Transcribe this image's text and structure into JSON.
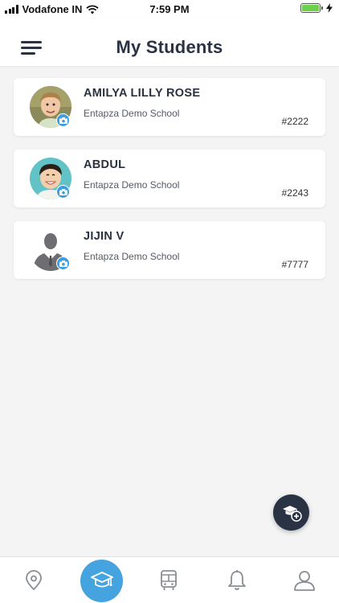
{
  "status_bar": {
    "carrier": "Vodafone IN",
    "time": "7:59 PM",
    "battery_level": 1.0,
    "battery_color": "#6cd04a"
  },
  "header": {
    "title": "My Students",
    "menu_icon": "hamburger-menu-icon"
  },
  "students": [
    {
      "name": "AMILYA LILLY ROSE",
      "school": "Entapza Demo School",
      "admission_no": "#2222",
      "avatar": "student-photo"
    },
    {
      "name": "ABDUL",
      "school": "Entapza Demo School",
      "admission_no": "#2243",
      "avatar": "student-photo"
    },
    {
      "name": "JIJIN V",
      "school": "Entapza Demo School",
      "admission_no": "#7777",
      "avatar": "default-person-silhouette"
    }
  ],
  "fab": {
    "icon": "add-student-icon"
  },
  "bottom_nav": {
    "items": [
      {
        "icon": "location-pin-icon",
        "active": false
      },
      {
        "icon": "graduation-cap-icon",
        "active": true
      },
      {
        "icon": "bus-icon",
        "active": false
      },
      {
        "icon": "bell-icon",
        "active": false
      },
      {
        "icon": "user-icon",
        "active": false
      }
    ],
    "active_color": "#45a3e0"
  },
  "colors": {
    "primary_dark": "#2a3344",
    "accent": "#45a3e0",
    "camera_badge": "#3c9de0"
  }
}
